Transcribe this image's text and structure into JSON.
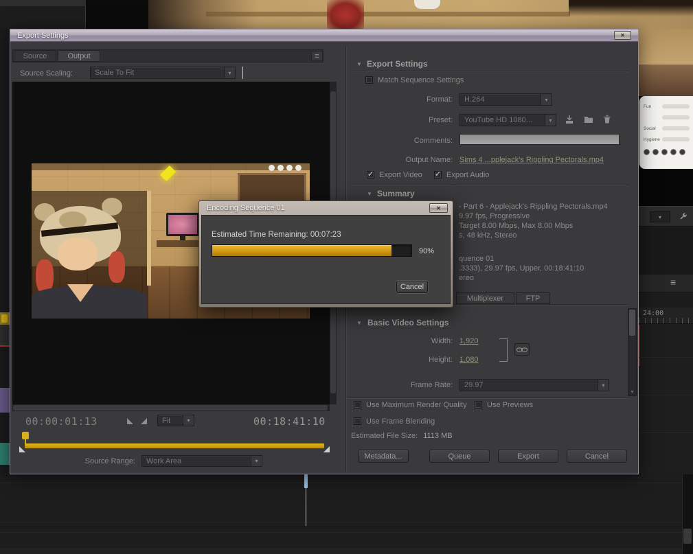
{
  "icons": {
    "close": "✕",
    "chevron_down": "▾",
    "disclosure_open": "▼",
    "panel_menu": "≡",
    "check": "✓",
    "scroll_down": "▼"
  },
  "colors": {
    "progress_gold": "#d79c14",
    "needs_green": "#4fae17",
    "playhead_blue": "#9ccaee",
    "work_area_yellow": "#d8a814"
  },
  "export_window": {
    "title": "Export Settings",
    "tabs": {
      "source": "Source",
      "output": "Output"
    },
    "source_scaling_label": "Source Scaling:",
    "source_scaling_value": "Scale To Fit",
    "timecode_current": "00:00:01:13",
    "zoom_value": "Fit",
    "timecode_duration": "00:18:41:10",
    "source_range_label": "Source Range:",
    "source_range_value": "Work Area"
  },
  "settings": {
    "header": "Export Settings",
    "match_sequence_label": "Match Sequence Settings",
    "format_label": "Format:",
    "format_value": "H.264",
    "preset_label": "Preset:",
    "preset_value": "YouTube HD 1080...",
    "comments_label": "Comments:",
    "comments_value": "",
    "output_name_label": "Output Name:",
    "output_name_value": "Sims 4 ...pplejack's Rippling Pectorals.mp4",
    "export_video_label": "Export Video",
    "export_audio_label": "Export Audio",
    "summary_header": "Summary",
    "summary_lines": [
      "- Part 6 - Applejack's Rippling Pectorals.mp4",
      "9.97 fps, Progressive",
      "Target 8.00 Mbps, Max 8.00 Mbps",
      "s, 48 kHz, Stereo",
      "quence 01",
      ".3333), 29.97 fps, Upper, 00:18:41:10",
      "ereo"
    ],
    "tab_multiplexer": "Multiplexer",
    "tab_ftp": "FTP",
    "basic_video_header": "Basic Video Settings",
    "width_label": "Width:",
    "width_value": "1,920",
    "height_label": "Height:",
    "height_value": "1,080",
    "frame_rate_label": "Frame Rate:",
    "frame_rate_value": "29.97",
    "use_max_render_label": "Use Maximum Render Quality",
    "use_previews_label": "Use Previews",
    "use_frame_blending_label": "Use Frame Blending",
    "estimated_size_label": "Estimated File Size:",
    "estimated_size_value": "1113 MB",
    "metadata_button": "Metadata...",
    "queue_button": "Queue",
    "export_button": "Export",
    "cancel_button": "Cancel"
  },
  "encoding_dialog": {
    "title": "Encoding Sequence 01",
    "time_remaining_label": "Estimated Time Remaining:",
    "time_remaining_value": "00:07:23",
    "progress_value": 90,
    "progress_percent": "90%",
    "cancel_button": "Cancel"
  },
  "background": {
    "ruler_label": "24:00",
    "needs": {
      "rows": [
        {
          "label": "Fun",
          "value": 88
        },
        {
          "label": "",
          "value": 96
        },
        {
          "label": "Social",
          "value": 82
        },
        {
          "label": "Hygiene",
          "value": 90
        }
      ]
    }
  }
}
